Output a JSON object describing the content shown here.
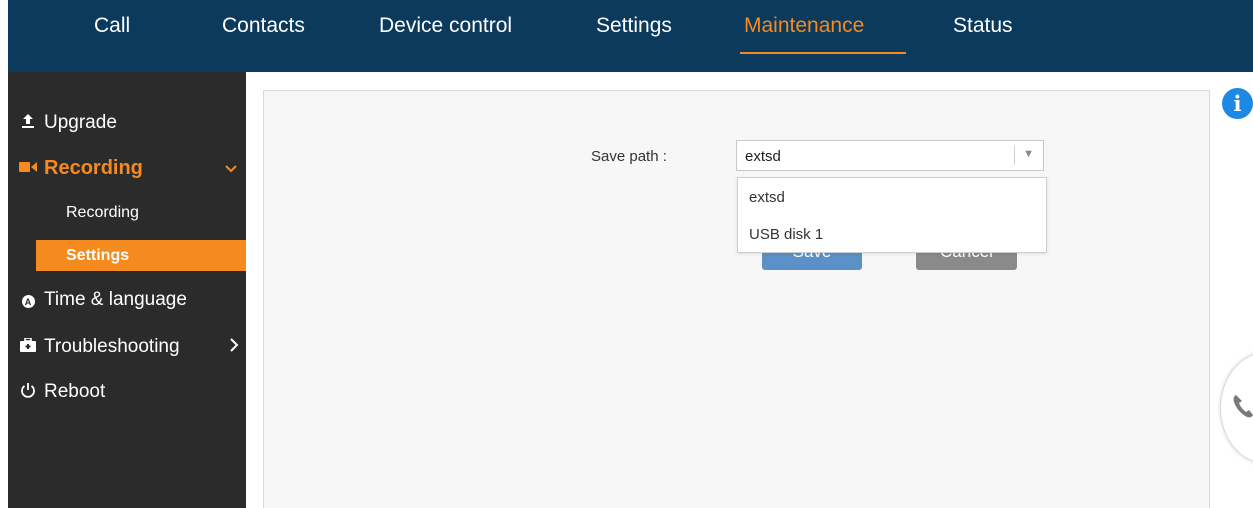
{
  "topnav": {
    "items": [
      {
        "label": "Call",
        "active": false
      },
      {
        "label": "Contacts",
        "active": false
      },
      {
        "label": "Device control",
        "active": false
      },
      {
        "label": "Settings",
        "active": false
      },
      {
        "label": "Maintenance",
        "active": true
      },
      {
        "label": "Status",
        "active": false
      }
    ]
  },
  "sidebar": {
    "items": [
      {
        "label": "Upgrade",
        "icon": "upload-icon"
      },
      {
        "label": "Recording",
        "icon": "video-camera-icon",
        "expanded": true,
        "children": [
          {
            "label": "Recording",
            "active": false
          },
          {
            "label": "Settings",
            "active": true
          }
        ]
      },
      {
        "label": "Time & language",
        "icon": "circle-a-icon"
      },
      {
        "label": "Troubleshooting",
        "icon": "toolbox-icon"
      },
      {
        "label": "Reboot",
        "icon": "power-icon"
      }
    ]
  },
  "form": {
    "save_path_label": "Save path :",
    "save_path_value": "extsd",
    "options": [
      "extsd",
      "USB disk 1"
    ],
    "save_label": "Save",
    "cancel_label": "Cancel"
  },
  "colors": {
    "topbar": "#0b3a5c",
    "accent": "#f58a1f",
    "sidebar": "#2b2b2b",
    "save_button": "#5b91c8",
    "cancel_button": "#8a8a8a",
    "info": "#1e88e5"
  },
  "icons": {
    "info": "i"
  }
}
